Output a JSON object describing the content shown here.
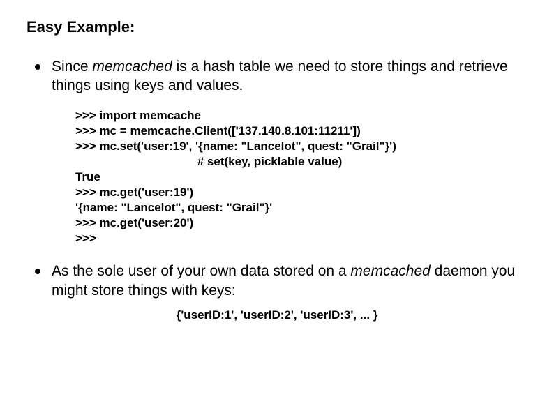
{
  "title": "Easy Example:",
  "bullet1": {
    "prefix": "Since ",
    "em": "memcached",
    "rest": " is a hash table we need to store things and retrieve things using keys and values."
  },
  "code": ">>> import memcache\n>>> mc = memcache.Client(['137.140.8.101:11211'])\n>>> mc.set('user:19', '{name: \"Lancelot\", quest: \"Grail\"}')\n                                     # set(key, picklable value)\nTrue\n>>> mc.get('user:19')\n'{name: \"Lancelot\", quest: \"Grail\"}'\n>>> mc.get('user:20')\n>>>",
  "bullet2": {
    "prefix": "As the sole user of your own data stored on a ",
    "em": "memcached",
    "rest": " daemon you might store things with keys:"
  },
  "keys_example": "{'userID:1', 'userID:2', 'userID:3', ... }"
}
